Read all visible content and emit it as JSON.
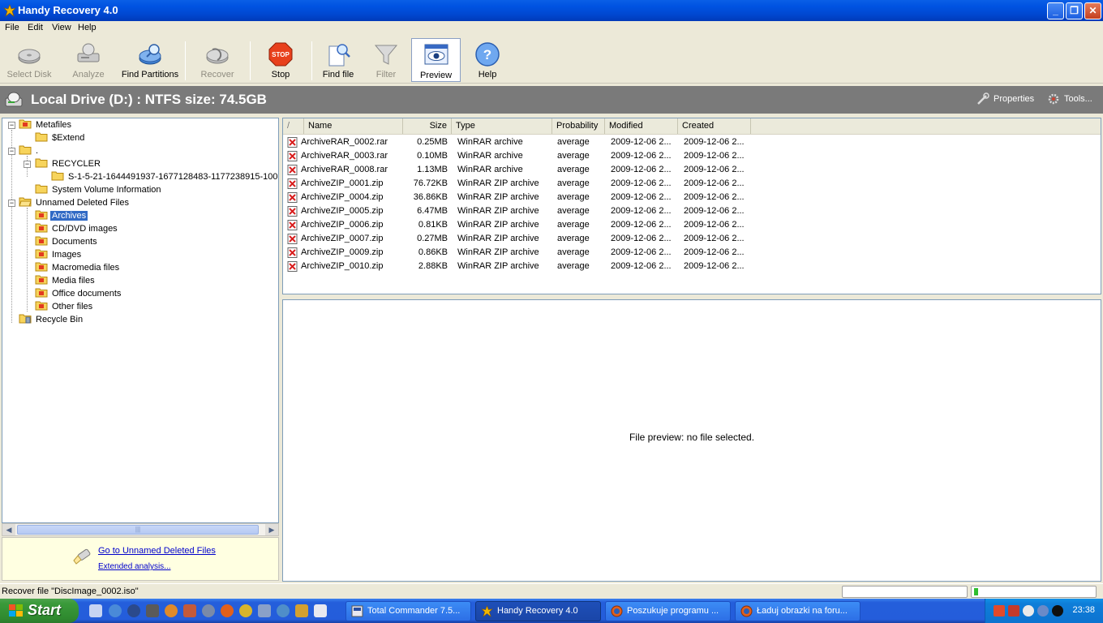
{
  "window": {
    "title": "Handy Recovery 4.0"
  },
  "menu": {
    "items": [
      "File",
      "Edit",
      "View",
      "Help"
    ]
  },
  "toolbar": {
    "buttons": [
      {
        "label": "Select Disk",
        "enabled": false,
        "icon": "disk-select-icon"
      },
      {
        "label": "Analyze",
        "enabled": false,
        "icon": "analyze-icon"
      },
      {
        "label": "Find Partitions",
        "enabled": true,
        "icon": "find-partitions-icon"
      },
      {
        "label": "Recover",
        "enabled": false,
        "icon": "recover-icon"
      },
      {
        "label": "Stop",
        "enabled": true,
        "icon": "stop-icon"
      },
      {
        "label": "Find file",
        "enabled": true,
        "icon": "find-file-icon"
      },
      {
        "label": "Filter",
        "enabled": false,
        "icon": "filter-icon"
      },
      {
        "label": "Preview",
        "enabled": true,
        "active": true,
        "icon": "preview-icon"
      },
      {
        "label": "Help",
        "enabled": true,
        "icon": "help-icon"
      }
    ]
  },
  "drivebar": {
    "title": "Local Drive (D:) : NTFS size: 74.5GB",
    "properties": "Properties",
    "tools": "Tools..."
  },
  "tree": {
    "items": [
      {
        "label": "Metafiles"
      },
      {
        "label": "$Extend"
      },
      {
        "label": "."
      },
      {
        "label": "RECYCLER"
      },
      {
        "label": "S-1-5-21-1644491937-1677128483-1177238915-1003"
      },
      {
        "label": "System Volume Information"
      },
      {
        "label": "Unnamed Deleted Files"
      },
      {
        "label": "Archives",
        "selected": true
      },
      {
        "label": "CD/DVD images"
      },
      {
        "label": "Documents"
      },
      {
        "label": "Images"
      },
      {
        "label": "Macromedia files"
      },
      {
        "label": "Media files"
      },
      {
        "label": "Office documents"
      },
      {
        "label": "Other files"
      },
      {
        "label": "Recycle Bin"
      }
    ]
  },
  "helper": {
    "link1": "Go to Unnamed Deleted Files",
    "link2": "Extended analysis..."
  },
  "list": {
    "columns": {
      "sort": "/",
      "name": "Name",
      "size": "Size",
      "type": "Type",
      "probability": "Probability",
      "modified": "Modified",
      "created": "Created"
    },
    "rows": [
      {
        "name": "ArchiveRAR_0002.rar",
        "size": "0.25MB",
        "type": "WinRAR archive",
        "probability": "average",
        "modified": "2009-12-06 2...",
        "created": "2009-12-06 2..."
      },
      {
        "name": "ArchiveRAR_0003.rar",
        "size": "0.10MB",
        "type": "WinRAR archive",
        "probability": "average",
        "modified": "2009-12-06 2...",
        "created": "2009-12-06 2..."
      },
      {
        "name": "ArchiveRAR_0008.rar",
        "size": "1.13MB",
        "type": "WinRAR archive",
        "probability": "average",
        "modified": "2009-12-06 2...",
        "created": "2009-12-06 2..."
      },
      {
        "name": "ArchiveZIP_0001.zip",
        "size": "76.72KB",
        "type": "WinRAR ZIP archive",
        "probability": "average",
        "modified": "2009-12-06 2...",
        "created": "2009-12-06 2..."
      },
      {
        "name": "ArchiveZIP_0004.zip",
        "size": "36.86KB",
        "type": "WinRAR ZIP archive",
        "probability": "average",
        "modified": "2009-12-06 2...",
        "created": "2009-12-06 2..."
      },
      {
        "name": "ArchiveZIP_0005.zip",
        "size": "6.47MB",
        "type": "WinRAR ZIP archive",
        "probability": "average",
        "modified": "2009-12-06 2...",
        "created": "2009-12-06 2..."
      },
      {
        "name": "ArchiveZIP_0006.zip",
        "size": "0.81KB",
        "type": "WinRAR ZIP archive",
        "probability": "average",
        "modified": "2009-12-06 2...",
        "created": "2009-12-06 2..."
      },
      {
        "name": "ArchiveZIP_0007.zip",
        "size": "0.27MB",
        "type": "WinRAR ZIP archive",
        "probability": "average",
        "modified": "2009-12-06 2...",
        "created": "2009-12-06 2..."
      },
      {
        "name": "ArchiveZIP_0009.zip",
        "size": "0.86KB",
        "type": "WinRAR ZIP archive",
        "probability": "average",
        "modified": "2009-12-06 2...",
        "created": "2009-12-06 2..."
      },
      {
        "name": "ArchiveZIP_0010.zip",
        "size": "2.88KB",
        "type": "WinRAR ZIP archive",
        "probability": "average",
        "modified": "2009-12-06 2...",
        "created": "2009-12-06 2..."
      }
    ]
  },
  "preview": {
    "message": "File preview: no file selected."
  },
  "status": {
    "text": "Recover file \"DiscImage_0002.iso\""
  },
  "taskbar": {
    "start": "Start",
    "tasks": [
      {
        "label": "Total Commander 7.5...",
        "active": false
      },
      {
        "label": "Handy Recovery 4.0",
        "active": true
      },
      {
        "label": "Poszukuje programu ...",
        "active": false
      },
      {
        "label": "Ładuj obrazki na foru...",
        "active": false
      }
    ],
    "clock": "23:38"
  },
  "colors": {
    "titlebar": "#0053e1",
    "drivebar": "#7a7a7a",
    "selection": "#316ac5",
    "taskbar": "#245edb",
    "start": "#3a9a3a",
    "link": "#0000cc"
  }
}
